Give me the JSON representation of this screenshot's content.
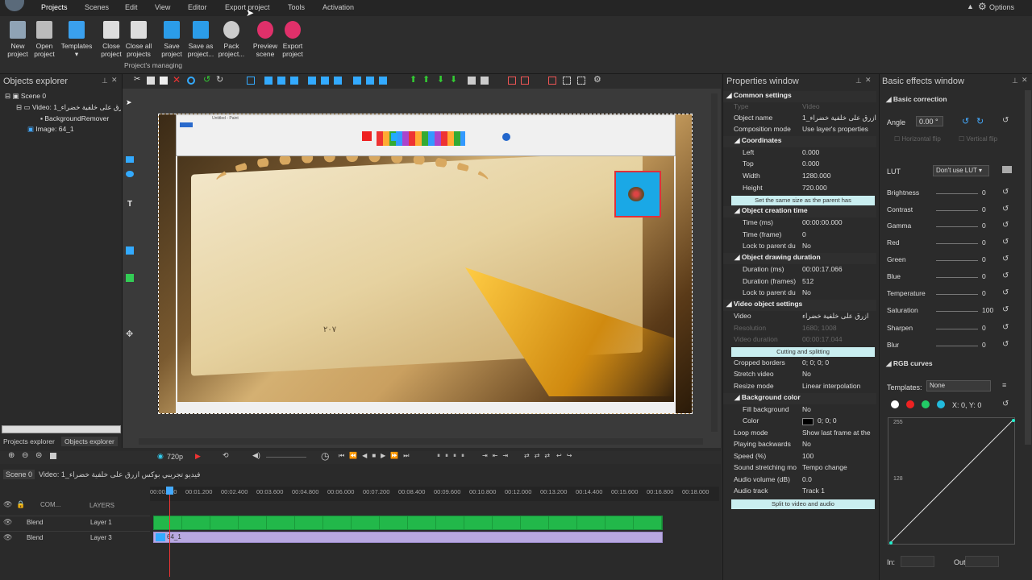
{
  "menu": [
    "Projects",
    "Scenes",
    "Edit",
    "View",
    "Editor",
    "Export project",
    "Tools",
    "Activation"
  ],
  "options_label": "Options",
  "ribbon": {
    "buttons": [
      {
        "l1": "New",
        "l2": "project",
        "color": "#9ab"
      },
      {
        "l1": "Open",
        "l2": "project",
        "color": "#ccc"
      },
      {
        "l1": "Templates",
        "l2": "",
        "color": "#4af"
      },
      {
        "l1": "Close",
        "l2": "project",
        "color": "#ddd"
      },
      {
        "l1": "Close all",
        "l2": "projects",
        "color": "#ddd"
      },
      {
        "l1": "Save",
        "l2": "project",
        "color": "#3af"
      },
      {
        "l1": "Save as",
        "l2": "project...",
        "color": "#3af"
      },
      {
        "l1": "Pack",
        "l2": "project...",
        "color": "#ddd"
      },
      {
        "l1": "Preview",
        "l2": "scene",
        "color": "#e04060"
      },
      {
        "l1": "Export",
        "l2": "project",
        "color": "#e04060"
      }
    ],
    "group_label": "Project's managing"
  },
  "objects_explorer": {
    "title": "Objects explorer",
    "tree": [
      "Scene 0",
      "Video: فيديو تجريبي بوكس ازرق على خلفية خضراء_1",
      "BackgroundRemover",
      "Image: 64_1"
    ],
    "tabs": [
      "Projects explorer",
      "Objects explorer"
    ]
  },
  "properties": {
    "title": "Properties window",
    "common": "Common settings",
    "rows1": [
      {
        "k": "Type",
        "v": "Video",
        "dim": true
      },
      {
        "k": "Object name",
        "v": "ازرق على خلفية خضراء_1"
      },
      {
        "k": "Composition mode",
        "v": "Use layer's properties"
      }
    ],
    "coords": "Coordinates",
    "coordrows": [
      {
        "k": "Left",
        "v": "0.000"
      },
      {
        "k": "Top",
        "v": "0.000"
      },
      {
        "k": "Width",
        "v": "1280.000"
      },
      {
        "k": "Height",
        "v": "720.000"
      }
    ],
    "same_size": "Set the same size as the parent has",
    "creation": "Object creation time",
    "creationrows": [
      {
        "k": "Time (ms)",
        "v": "00:00:00.000"
      },
      {
        "k": "Time (frame)",
        "v": "0"
      },
      {
        "k": "Lock to parent du",
        "v": "No"
      }
    ],
    "drawing": "Object drawing duration",
    "drawingrows": [
      {
        "k": "Duration (ms)",
        "v": "00:00:17.066"
      },
      {
        "k": "Duration (frames)",
        "v": "512"
      },
      {
        "k": "Lock to parent du",
        "v": "No"
      }
    ],
    "video": "Video object settings",
    "videorows": [
      {
        "k": "Video",
        "v": "ازرق على خلفية خضراء"
      },
      {
        "k": "Resolution",
        "v": "1680; 1008",
        "dim": true
      },
      {
        "k": "Video duration",
        "v": "00:00:17.044",
        "dim": true
      }
    ],
    "cutting": "Cutting and splitting",
    "morerows": [
      {
        "k": "Cropped borders",
        "v": "0; 0; 0; 0"
      },
      {
        "k": "Stretch video",
        "v": "No"
      },
      {
        "k": "Resize mode",
        "v": "Linear interpolation"
      }
    ],
    "bg": "Background color",
    "bgrows": [
      {
        "k": "Fill background",
        "v": "No"
      },
      {
        "k": "Color",
        "v": "0; 0; 0"
      }
    ],
    "lastrows": [
      {
        "k": "Loop mode",
        "v": "Show last frame at the"
      },
      {
        "k": "Playing backwards",
        "v": "No"
      },
      {
        "k": "Speed (%)",
        "v": "100"
      },
      {
        "k": "Sound stretching mo",
        "v": "Tempo change"
      },
      {
        "k": "Audio volume (dB)",
        "v": "0.0"
      },
      {
        "k": "Audio track",
        "v": "Track 1"
      }
    ],
    "split": "Split to video and audio"
  },
  "effects": {
    "title": "Basic effects window",
    "basic": "Basic correction",
    "angle_label": "Angle",
    "angle_value": "0.00 °",
    "hflip": "Horizontal flip",
    "vflip": "Vertical flip",
    "lut_label": "LUT",
    "lut_value": "Don't use LUT",
    "sliders": [
      {
        "k": "Brightness",
        "v": "0"
      },
      {
        "k": "Contrast",
        "v": "0"
      },
      {
        "k": "Gamma",
        "v": "0"
      },
      {
        "k": "Red",
        "v": "0"
      },
      {
        "k": "Green",
        "v": "0"
      },
      {
        "k": "Blue",
        "v": "0"
      },
      {
        "k": "Temperature",
        "v": "0"
      },
      {
        "k": "Saturation",
        "v": "100"
      },
      {
        "k": "Sharpen",
        "v": "0"
      },
      {
        "k": "Blur",
        "v": "0"
      }
    ],
    "rgb": "RGB curves",
    "templates_label": "Templates:",
    "templates_value": "None",
    "xy": "X: 0, Y: 0",
    "y255": "255",
    "y128": "128",
    "in_label": "In:",
    "out_label": "Out:"
  },
  "timeline": {
    "zoom": "720p",
    "tabs": [
      "Scene 0",
      "Video: فيديو تجريبي بوكس ازرق على خلفية خضراء_1"
    ],
    "ticks": [
      "00:00.000",
      "00:01.200",
      "00:02.400",
      "00:03.600",
      "00:04.800",
      "00:06.000",
      "00:07.200",
      "00:08.400",
      "00:09.600",
      "00:10.800",
      "00:12.000",
      "00:13.200",
      "00:14.400",
      "00:15.600",
      "00:16.800",
      "00:18.000"
    ],
    "com": "COM...",
    "layers_label": "LAYERS",
    "tracks": [
      {
        "blend": "Blend",
        "name": "Layer 1"
      },
      {
        "blend": "Blend",
        "name": "Layer 3"
      }
    ],
    "clip2": "64_1"
  },
  "preview_app": {
    "title": "Untitled - Paint",
    "page_arabic": "٢٠٧"
  }
}
